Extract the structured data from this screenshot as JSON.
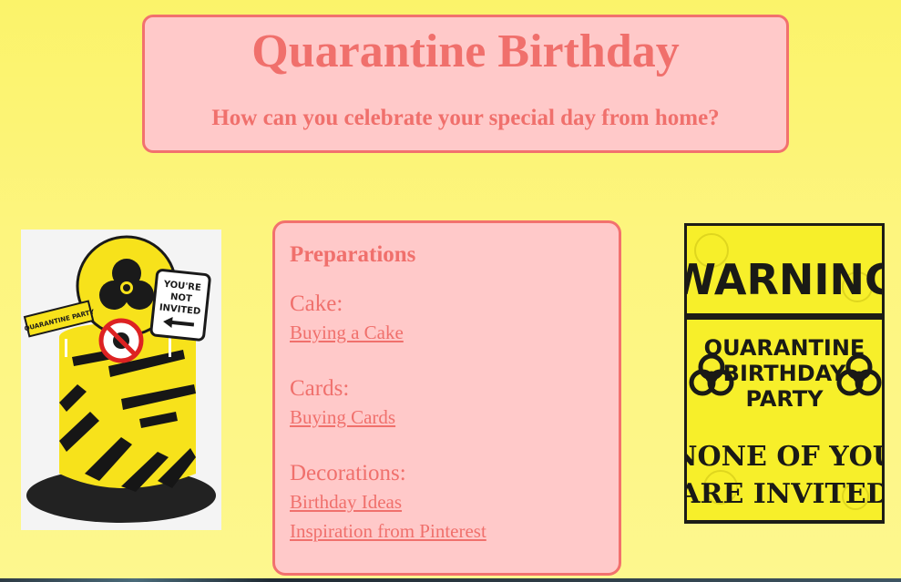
{
  "header": {
    "title": "Quarantine Birthday",
    "subtitle": "How can you celebrate your special day from home?"
  },
  "preparations": {
    "heading": "Preparations",
    "sections": [
      {
        "title": "Cake:",
        "links": [
          "Buying a Cake"
        ]
      },
      {
        "title": "Cards:",
        "links": [
          "Buying Cards"
        ]
      },
      {
        "title": "Decorations:",
        "links": [
          "Birthday Ideas",
          "Inspiration from Pinterest"
        ]
      }
    ]
  },
  "cake_image": {
    "sign_text": "YOU'RE NOT INVITED",
    "tape_text": "QUARANTINE PARTY"
  },
  "poster_image": {
    "warning": "WARNING",
    "line1": "QUARANTINE",
    "line2": "BIRTHDAY",
    "line3": "PARTY",
    "line4": "NONE OF YOU",
    "line5": "ARE INVITED"
  },
  "colors": {
    "background": "#fbf36a",
    "box_fill": "#ffc9c9",
    "accent": "#f0706c",
    "hazard_yellow": "#f7e21b"
  }
}
